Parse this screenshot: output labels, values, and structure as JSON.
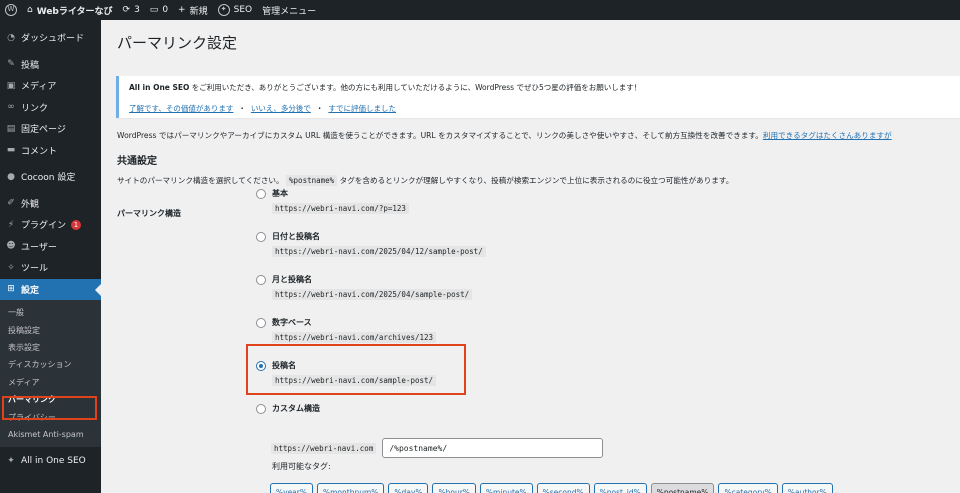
{
  "adminbar": {
    "site_name": "Webライターなび",
    "updates": "3",
    "comments": "0",
    "new": "新規",
    "seo": "SEO",
    "admin_menu": "管理メニュー"
  },
  "menu": {
    "items": [
      {
        "label": "ダッシュボード",
        "icon": "dashboard-icon"
      },
      {
        "label": "投稿",
        "icon": "pin-icon"
      },
      {
        "label": "メディア",
        "icon": "media-icon"
      },
      {
        "label": "リンク",
        "icon": "link-icon"
      },
      {
        "label": "固定ページ",
        "icon": "page-icon"
      },
      {
        "label": "コメント",
        "icon": "comment-icon"
      },
      {
        "label": "Cocoon 設定",
        "icon": "cocoon-icon"
      },
      {
        "label": "外観",
        "icon": "brush-icon"
      },
      {
        "label": "プラグイン",
        "icon": "plugin-icon",
        "badge": "1"
      },
      {
        "label": "ユーザー",
        "icon": "user-icon"
      },
      {
        "label": "ツール",
        "icon": "wrench-icon"
      },
      {
        "label": "設定",
        "icon": "settings-icon"
      }
    ],
    "submenu": [
      "一般",
      "投稿設定",
      "表示設定",
      "ディスカッション",
      "メディア",
      "パーマリンク",
      "プライバシー",
      "Akismet Anti-spam"
    ],
    "aioseo": "All in One SEO"
  },
  "page": {
    "title": "パーマリンク設定"
  },
  "notice": {
    "brand": "All in One SEO",
    "text": " をご利用いただき、ありがとうございます。他の方にも利用していただけるように、WordPress でぜひ5つ星の評価をお願いします！",
    "link1": "了解です、その価値があります",
    "sep1": "・",
    "link2": "いいえ、多分後で",
    "sep2": "・",
    "link3": "すでに評価しました"
  },
  "intro": {
    "text": "WordPress ではパーマリンクやアーカイブにカスタム URL 構造を使うことができます。URL をカスタマイズすることで、リンクの美しさや使いやすさ、そして前方互換性を改善できます。",
    "link": "利用できるタグはたくさんありますが"
  },
  "common": {
    "heading": "共通設定",
    "desc_pre": "サイトのパーマリンク構造を選択してください。",
    "desc_code": "%postname%",
    "desc_post": " タグを含めるとリンクが理解しやすくなり、投稿が検索エンジンで上位に表示されるのに役立つ可能性があります。",
    "field_label": "パーマリンク構造"
  },
  "options": [
    {
      "label": "基本",
      "example": "https://webri-navi.com/?p=123"
    },
    {
      "label": "日付と投稿名",
      "example": "https://webri-navi.com/2025/04/12/sample-post/"
    },
    {
      "label": "月と投稿名",
      "example": "https://webri-navi.com/2025/04/sample-post/"
    },
    {
      "label": "数字ベース",
      "example": "https://webri-navi.com/archives/123"
    },
    {
      "label": "投稿名",
      "example": "https://webri-navi.com/sample-post/"
    },
    {
      "label": "カスタム構造",
      "example": ""
    }
  ],
  "selected_option": "投稿名",
  "custom": {
    "prefix": "https://webri-navi.com",
    "value": "/%postname%/",
    "tags_label": "利用可能なタグ:"
  },
  "tags": [
    "%year%",
    "%monthnum%",
    "%day%",
    "%hour%",
    "%minute%",
    "%second%",
    "%post_id%",
    "%postname%",
    "%category%",
    "%author%"
  ],
  "active_tag": "%postname%",
  "colors": {
    "accent": "#2271b1",
    "highlight": "#e0421b",
    "sidebar": "#1d2327"
  }
}
